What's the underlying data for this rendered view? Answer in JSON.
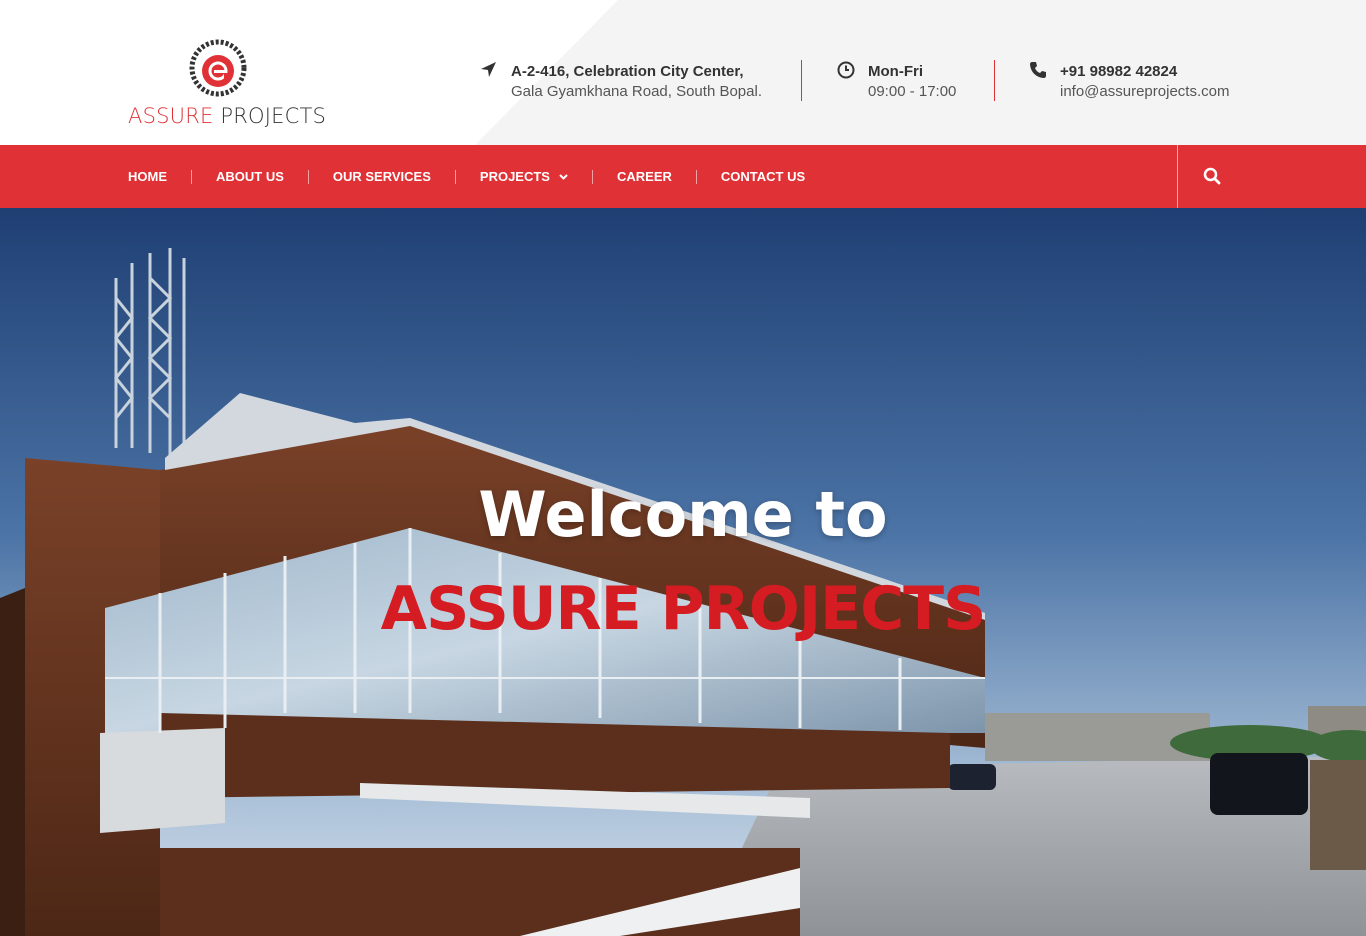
{
  "brand": {
    "logo_word1": "ASSURE",
    "logo_word2": "PROJECTS",
    "accent_color": "#e03236"
  },
  "contact": {
    "address_line1": "A-2-416, Celebration City Center,",
    "address_line2": "Gala Gyamkhana Road, South Bopal.",
    "hours_line1": "Mon-Fri",
    "hours_line2": "09:00 - 17:00",
    "phone": "+91 98982 42824",
    "email": "info@assureprojects.com",
    "icons": [
      "location-arrow-icon",
      "clock-icon",
      "phone-icon"
    ]
  },
  "nav": {
    "items": [
      {
        "label": "HOME"
      },
      {
        "label": "ABOUT US"
      },
      {
        "label": "OUR SERVICES"
      },
      {
        "label": "PROJECTS",
        "has_dropdown": true
      },
      {
        "label": "CAREER"
      },
      {
        "label": "CONTACT US"
      }
    ],
    "search_icon": "search-icon"
  },
  "hero": {
    "title_line1": "Welcome to",
    "title_line2": "ASSURE PROJECTS"
  }
}
